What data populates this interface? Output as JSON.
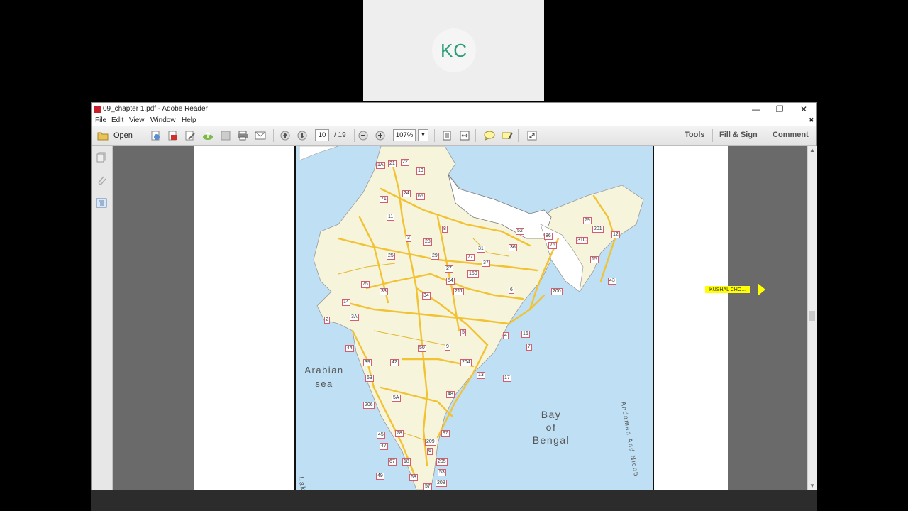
{
  "participant": {
    "initials": "KC"
  },
  "window": {
    "title": "09_chapter 1.pdf - Adobe Reader",
    "controls": {
      "minimize": "—",
      "restore": "❐",
      "close": "✕",
      "doc_close": "✖"
    }
  },
  "menu": {
    "items": [
      "File",
      "Edit",
      "View",
      "Window",
      "Help"
    ]
  },
  "toolbar": {
    "open_label": "Open",
    "page_current": "10",
    "page_total": "/ 19",
    "zoom": "107%",
    "tools_label": "Tools",
    "fill_sign_label": "Fill & Sign",
    "comment_label": "Comment"
  },
  "map": {
    "labels": {
      "arabian_sea_1": "Arabian",
      "arabian_sea_2": "sea",
      "bay_1": "Bay",
      "bay_2": "of",
      "bay_3": "Bengal",
      "lakshadweep": "Lakshdw",
      "andaman": "Andaman And Nicob"
    },
    "highway_numbers": [
      "1A",
      "21",
      "22",
      "10",
      "71",
      "24",
      "65",
      "8",
      "11",
      "3",
      "25",
      "28",
      "29",
      "77",
      "31",
      "37",
      "36",
      "52",
      "76",
      "86",
      "79",
      "12",
      "75",
      "27",
      "33",
      "34",
      "54",
      "150",
      "6",
      "200",
      "201",
      "43",
      "5",
      "4",
      "16",
      "7",
      "9",
      "13",
      "17",
      "204",
      "48",
      "63",
      "206",
      "45",
      "47",
      "209",
      "67",
      "68",
      "208",
      "205",
      "31C",
      "15",
      "14",
      "3A",
      "2",
      "39",
      "44",
      "42",
      "5A",
      "50",
      "211",
      "18",
      "49",
      "53",
      "57",
      "6",
      "78",
      "97"
    ]
  },
  "pointer": {
    "label": "KUSHAL CHO..."
  },
  "colors": {
    "highway": "#f1c232",
    "land": "#f7f4dc",
    "sea": "#bfe0f4",
    "avatar_text": "#2e9e79",
    "pointer": "#ffff00"
  }
}
